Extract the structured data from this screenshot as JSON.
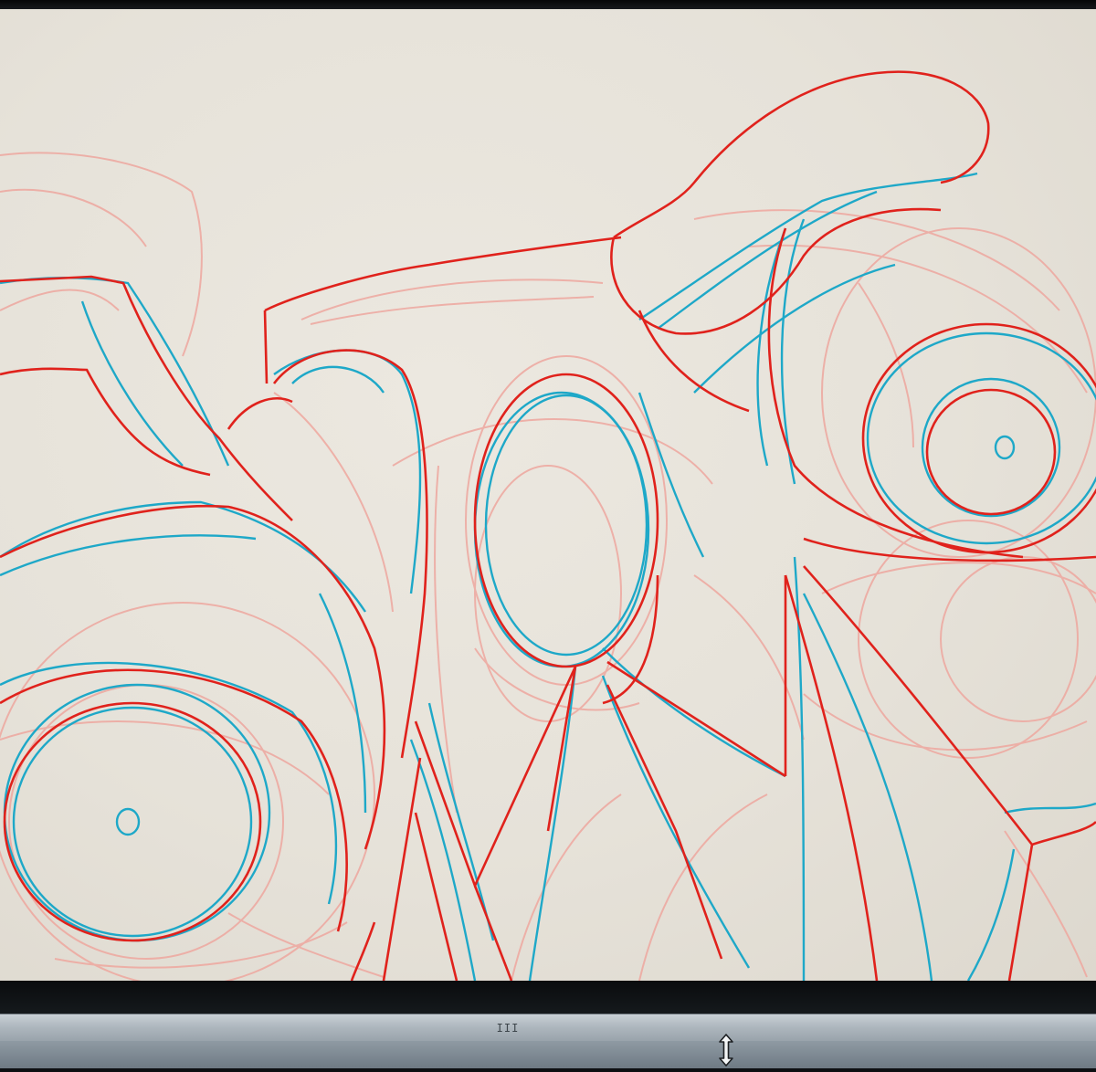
{
  "window": {
    "canvas_description_hidden": "",
    "scroll_grip_label": "III"
  },
  "icons": {
    "scroll_grip": "grip-icon",
    "resize_handle": "vertical-resize-icon"
  },
  "colors": {
    "canvas": "#e8e4dc",
    "stroke_red": "#e0251f",
    "stroke_cyan": "#1fa8c9",
    "stroke_pink": "#f0a8a0",
    "scrollbar": "#b4bdc4"
  }
}
